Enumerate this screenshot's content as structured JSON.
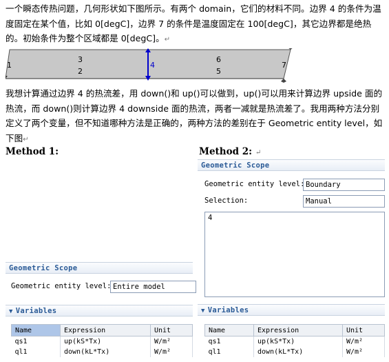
{
  "paragraph1": {
    "text": "一个瞬态传热问题，几何形状如下图所示。有两个 domain，它们的材料不同。边界 4 的条件为温度固定在某个值，比如 0[degC]，边界 7 的条件是温度固定在 100[degC]，其它边界都是绝热的。初始条件为整个区域都是 0[degC]。",
    "return_mark": "↵"
  },
  "geometry": {
    "labels": {
      "b1": "1",
      "b3": "3",
      "b2": "2",
      "b4": "4",
      "b6": "6",
      "b5": "5",
      "b7": "7"
    },
    "highlight_color": "#0000cc",
    "fill_color": "#c8c8c8"
  },
  "paragraph2": {
    "text": "我想计算通过边界 4 的热流差，用 down()和 up()可以做到，up()可以用来计算边界 upside 面的热流，而 down()则计算边界 4 downside 面的热流，两者一减就是热流差了。我用两种方法分别定义了两个变量，但不知道哪种方法是正确的，两种方法的差别在于 Geometric entity level，如下图",
    "return_mark": "↵"
  },
  "method1": {
    "heading": "Method 1:",
    "geometric_scope": {
      "title": "Geometric Scope",
      "entity_level_label": "Geometric entity level:",
      "entity_level_value": "Entire model"
    },
    "variables": {
      "title": "Variables",
      "columns": [
        "Name",
        "Expression",
        "Unit"
      ],
      "rows": [
        [
          "qs1",
          "up(kS*Tx)",
          "W/m²"
        ],
        [
          "ql1",
          "down(kL*Tx)",
          "W/m²"
        ]
      ]
    }
  },
  "method2": {
    "heading": "Method 2:",
    "return_mark": "↵",
    "geometric_scope": {
      "title": "Geometric Scope",
      "entity_level_label": "Geometric entity level:",
      "entity_level_value": "Boundary",
      "selection_label": "Selection:",
      "selection_value": "Manual",
      "selection_list": "4"
    },
    "variables": {
      "title": "Variables",
      "columns": [
        "Name",
        "Expression",
        "Unit"
      ],
      "rows": [
        [
          "qs1",
          "up(kS*Tx)",
          "W/m²"
        ],
        [
          "ql1",
          "down(kL*Tx)",
          "W/m²"
        ]
      ]
    }
  }
}
